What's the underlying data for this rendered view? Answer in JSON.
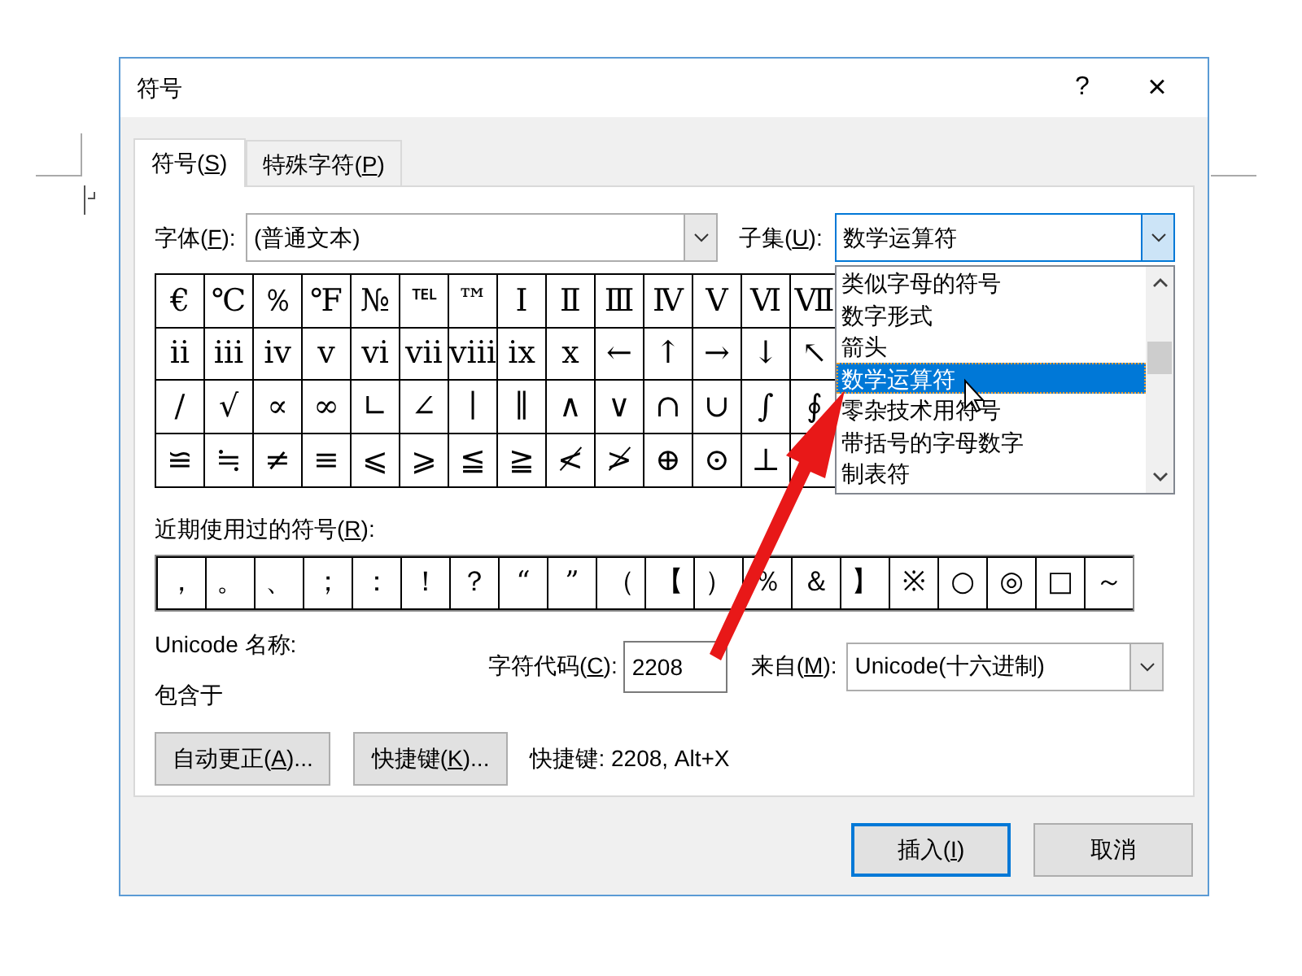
{
  "window": {
    "title": "符号",
    "help": "?",
    "close": "×"
  },
  "tabs": [
    {
      "pre": "符号(",
      "key": "S",
      "post": ")",
      "selected": true
    },
    {
      "pre": "特殊字符(",
      "key": "P",
      "post": ")",
      "selected": false
    }
  ],
  "font": {
    "label": {
      "pre": "字体(",
      "key": "F",
      "post": "):"
    },
    "value": "(普通文本)"
  },
  "subset": {
    "label": {
      "pre": "子集(",
      "key": "U",
      "post": "):"
    },
    "value": "数学运算符",
    "expanded": true,
    "options": [
      {
        "text": "类似字母的符号",
        "selected": false
      },
      {
        "text": "数字形式",
        "selected": false
      },
      {
        "text": "箭头",
        "selected": false
      },
      {
        "text": "数学运算符",
        "selected": true
      },
      {
        "text": "零杂技术用符号",
        "selected": false
      },
      {
        "text": "带括号的字母数字",
        "selected": false
      },
      {
        "text": "制表符",
        "selected": false
      }
    ]
  },
  "symbols": [
    [
      "€",
      "℃",
      "％",
      "℉",
      "№",
      "℡",
      "™",
      "Ⅰ",
      "Ⅱ",
      "Ⅲ",
      "Ⅳ",
      "Ⅴ",
      "Ⅵ",
      "Ⅶ"
    ],
    [
      "ⅱ",
      "ⅲ",
      "ⅳ",
      "ⅴ",
      "ⅵ",
      "ⅶ",
      "ⅷ",
      "ⅸ",
      "ⅹ",
      "←",
      "↑",
      "→",
      "↓",
      "↖"
    ],
    [
      "∕",
      "√",
      "∝",
      "∞",
      "∟",
      "∠",
      "∣",
      "∥",
      "∧",
      "∨",
      "∩",
      "∪",
      "∫",
      "∮"
    ],
    [
      "≌",
      "≒",
      "≠",
      "≡",
      "⩽",
      "⩾",
      "≦",
      "≧",
      "≮",
      "≯",
      "⊕",
      "⊙",
      "⊥"
    ]
  ],
  "recent": {
    "label": {
      "pre": "近期使用过的符号(",
      "key": "R",
      "post": "):"
    },
    "symbols": [
      "，",
      "。",
      "、",
      "；",
      "：",
      "！",
      "？",
      "“",
      "”",
      "（",
      "【",
      "）",
      "％",
      "＆",
      "】",
      "※",
      "○",
      "◎",
      "□",
      "～"
    ]
  },
  "unicode_name_label": "Unicode 名称:",
  "contained_in_label": "包含于",
  "char_code": {
    "label": {
      "pre": "字符代码(",
      "key": "C",
      "post": "):"
    },
    "value": "2208"
  },
  "source": {
    "label": {
      "pre": "来自(",
      "key": "M",
      "post": "):"
    },
    "value": "Unicode(十六进制)"
  },
  "buttons": [
    {
      "pre": "自动更正(",
      "key": "A",
      "post": ")..."
    },
    {
      "pre": "快捷键(",
      "key": "K",
      "post": ")..."
    }
  ],
  "shortcut_text": "快捷键: 2208, Alt+X",
  "footer_buttons": [
    {
      "pre": "插入(",
      "key": "I",
      "post": ")",
      "default": true
    },
    {
      "pre": "取消",
      "default": false
    }
  ]
}
